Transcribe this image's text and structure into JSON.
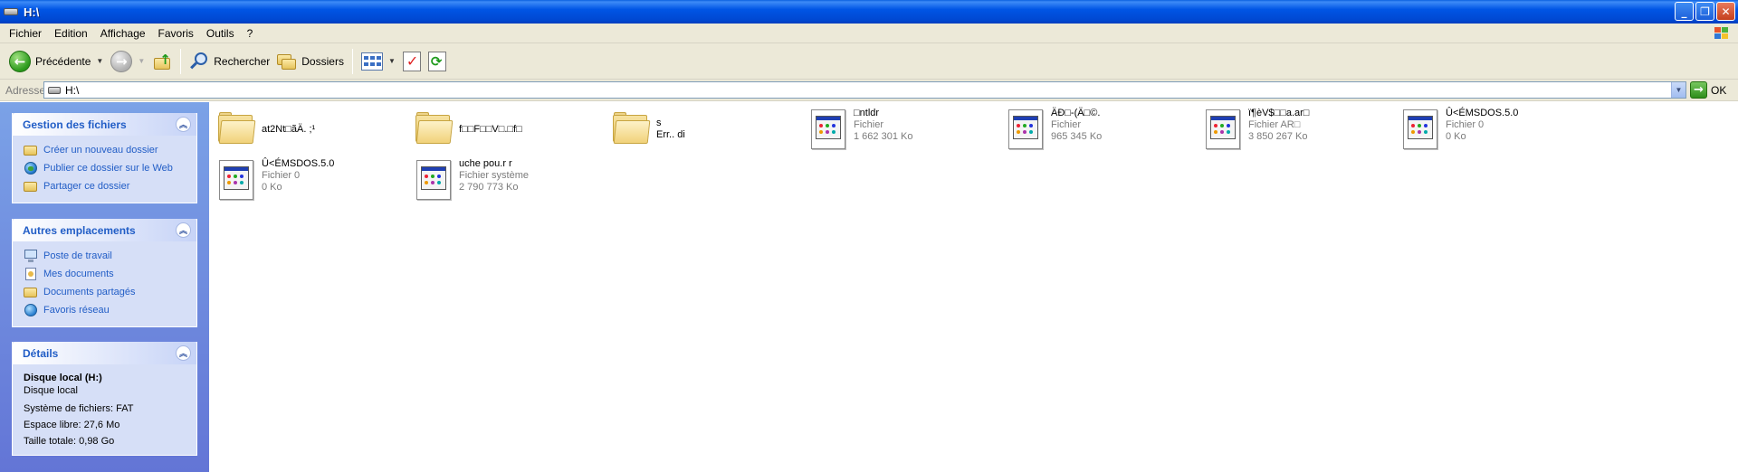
{
  "window": {
    "title": "H:\\"
  },
  "menu": [
    "Fichier",
    "Edition",
    "Affichage",
    "Favoris",
    "Outils",
    "?"
  ],
  "toolbar": {
    "back_label": "Précédente",
    "search_label": "Rechercher",
    "folders_label": "Dossiers"
  },
  "address": {
    "label": "Adresse",
    "value": "H:\\",
    "go_label": "OK"
  },
  "file_tasks": {
    "title": "Gestion des fichiers",
    "items": [
      {
        "label": "Créer un nouveau dossier",
        "icon": "new-folder-icon"
      },
      {
        "label": "Publier ce dossier sur le Web",
        "icon": "publish-web-icon"
      },
      {
        "label": "Partager ce dossier",
        "icon": "share-folder-icon"
      }
    ]
  },
  "other_places": {
    "title": "Autres emplacements",
    "items": [
      {
        "label": "Poste de travail",
        "icon": "my-computer-icon"
      },
      {
        "label": "Mes documents",
        "icon": "my-documents-icon"
      },
      {
        "label": "Documents partagés",
        "icon": "shared-documents-icon"
      },
      {
        "label": "Favoris réseau",
        "icon": "network-places-icon"
      }
    ]
  },
  "details": {
    "title": "Détails",
    "name": "Disque local (H:)",
    "type": "Disque local",
    "filesystem": "Système de fichiers: FAT",
    "free": "Espace libre: 27,6 Mo",
    "total": "Taille totale: 0,98 Go"
  },
  "files": [
    {
      "kind": "folder",
      "name": "at2Nt□ãÄ. ;¹",
      "line2": "",
      "line3": ""
    },
    {
      "kind": "folder",
      "name": "f□□F□□V□.□f□",
      "line2": "",
      "line3": ""
    },
    {
      "kind": "folder",
      "name": "s",
      "line2": "Err.. di",
      "line3": ""
    },
    {
      "kind": "file",
      "name": "□ntldr",
      "line2": "Fichier",
      "line3": "1 662 301 Ko"
    },
    {
      "kind": "file",
      "name": "ÄÐ□-(Ä□©.",
      "line2": "Fichier",
      "line3": "965 345 Ko"
    },
    {
      "kind": "file",
      "name": "ï¶èV$□□a.ar□",
      "line2": "Fichier AR□",
      "line3": "3 850 267 Ko"
    },
    {
      "kind": "file",
      "name": "Û<ÉMSDOS.5.0",
      "line2": "Fichier 0",
      "line3": "0 Ko"
    },
    {
      "kind": "file",
      "name": "Û<ÉMSDOS.5.0",
      "line2": "Fichier 0",
      "line3": "0 Ko"
    },
    {
      "kind": "file",
      "name": "uche pou.r r",
      "line2": "Fichier système",
      "line3": "2 790 773 Ko"
    }
  ]
}
